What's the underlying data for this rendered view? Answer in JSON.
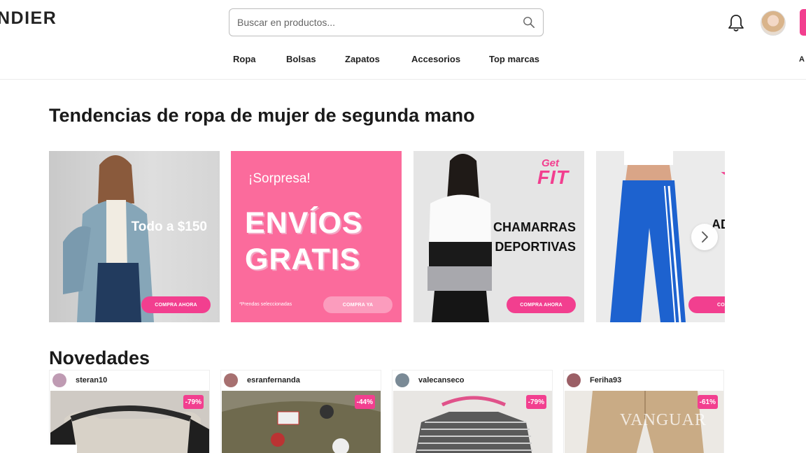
{
  "header": {
    "logo": "NDIER",
    "search": {
      "placeholder": "Buscar en productos..."
    },
    "nav": [
      "Ropa",
      "Bolsas",
      "Zapatos",
      "Accesorios",
      "Top marcas"
    ],
    "nav_extra": "A",
    "icons": [
      "search-icon",
      "bell-icon",
      "avatar"
    ],
    "accent": "#f23f8f"
  },
  "trends": {
    "title": "Tendencias de ropa de mujer de segunda mano",
    "banners": [
      {
        "text": "Todo a $150",
        "cta": "COMPRA AHORA"
      },
      {
        "sub": "¡Sorpresa!",
        "main_1": "ENVÍOS",
        "main_2": "GRATIS",
        "note": "*Prendas seleccionadas",
        "cta": "COMPRA YA"
      },
      {
        "badge_1": "Get",
        "badge_2": "FIT",
        "text_1": "CHAMARRAS",
        "text_2": "DEPORTIVAS",
        "cta": "COMPRA AHORA"
      },
      {
        "text": "AD",
        "cta": "COM"
      }
    ]
  },
  "novedades": {
    "title": "Novedades",
    "products": [
      {
        "seller": "steran10",
        "discount": "-79%"
      },
      {
        "seller": "esranfernanda",
        "discount": "-44%"
      },
      {
        "seller": "valecanseco",
        "discount": "-79%"
      },
      {
        "seller": "Feriha93",
        "discount": "-61%"
      }
    ]
  },
  "watermark": "VANGUAR"
}
